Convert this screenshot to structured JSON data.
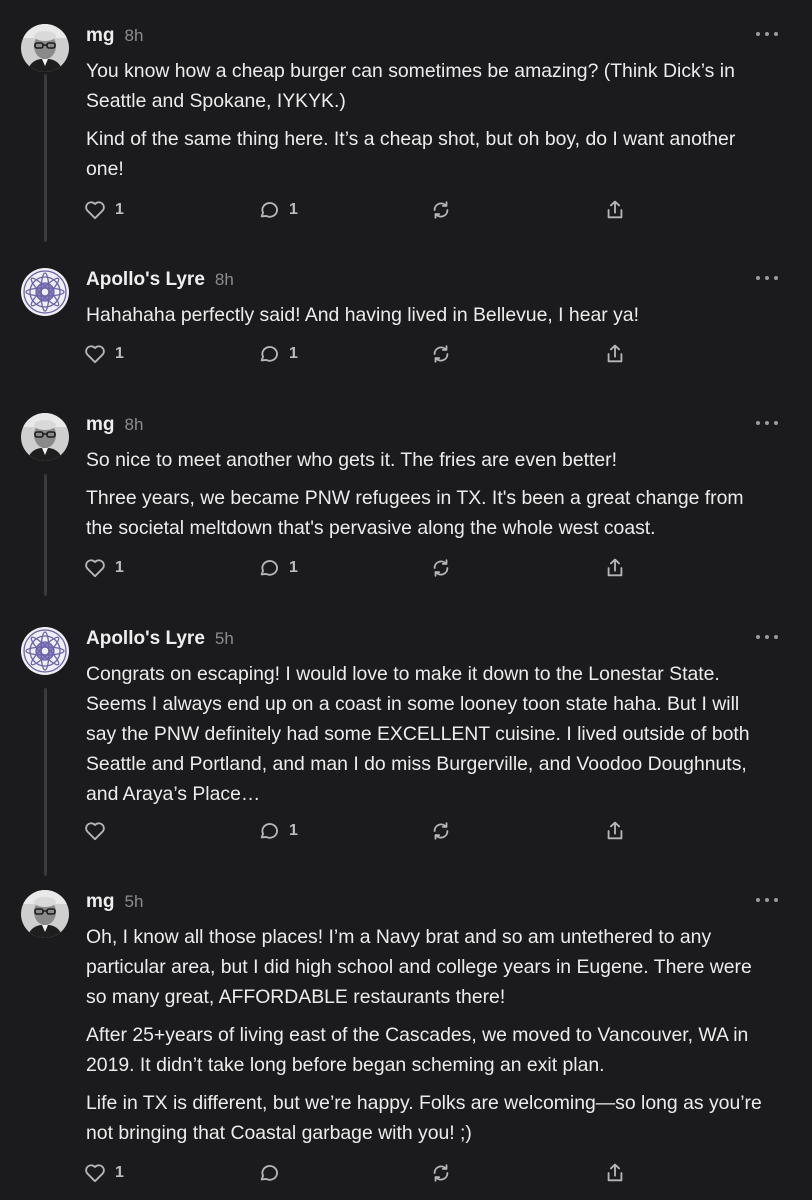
{
  "comments": [
    {
      "author": "mg",
      "time": "8h",
      "avatar": "man-with-glasses-avatar",
      "paragraphs": [
        "You know how a cheap burger can sometimes be amazing? (Think Dick’s in Seattle and Spokane, IYKYK.)",
        "Kind of the same thing here. It’s a cheap shot, but oh boy, do I want another one!"
      ],
      "likes": "1",
      "replies": "1"
    },
    {
      "author": "Apollo's Lyre",
      "time": "8h",
      "avatar": "mandala-avatar",
      "paragraphs": [
        "Hahahaha perfectly said! And having lived in Bellevue, I hear ya!"
      ],
      "likes": "1",
      "replies": "1"
    },
    {
      "author": "mg",
      "time": "8h",
      "avatar": "man-with-glasses-avatar",
      "paragraphs": [
        "So nice to meet another who gets it. The fries are even better!",
        "Three years, we became PNW refugees in TX. It's been a great change from the societal meltdown that's pervasive along the whole west coast."
      ],
      "likes": "1",
      "replies": "1"
    },
    {
      "author": "Apollo's Lyre",
      "time": "5h",
      "avatar": "mandala-avatar",
      "paragraphs": [
        "Congrats on escaping! I would love to make it down to the Lonestar State. Seems I always end up on a coast in some looney toon state haha. But I will say the PNW definitely had some EXCELLENT cuisine. I lived outside of both Seattle and Portland, and man I do miss Burgerville, and Voodoo Doughnuts, and Araya’s Place…"
      ],
      "likes": "",
      "replies": "1"
    },
    {
      "author": "mg",
      "time": "5h",
      "avatar": "man-with-glasses-avatar",
      "paragraphs": [
        "Oh, I know all those places! I’m a Navy brat and so am untethered to any particular area, but I did high school and college years in Eugene. There were so many great, AFFORDABLE restaurants there!",
        "After 25+years of living east of the Cascades, we moved to Vancouver, WA in 2019. It didn’t take long before began scheming an exit plan.",
        "Life in TX is different, but we’re happy. Folks are welcoming—so long as you’re not bringing that Coastal garbage with you! ;)"
      ],
      "likes": "1",
      "replies": ""
    }
  ],
  "icons": {
    "like": "heart-icon",
    "reply": "speech-bubble-icon",
    "restack": "restack-arrows-icon",
    "share": "share-icon",
    "more": "more-options-icon"
  },
  "colors": {
    "background": "#1b1b1d",
    "text": "#ececec",
    "muted": "#8c8c8f",
    "thread_line": "#3a3a3c"
  }
}
